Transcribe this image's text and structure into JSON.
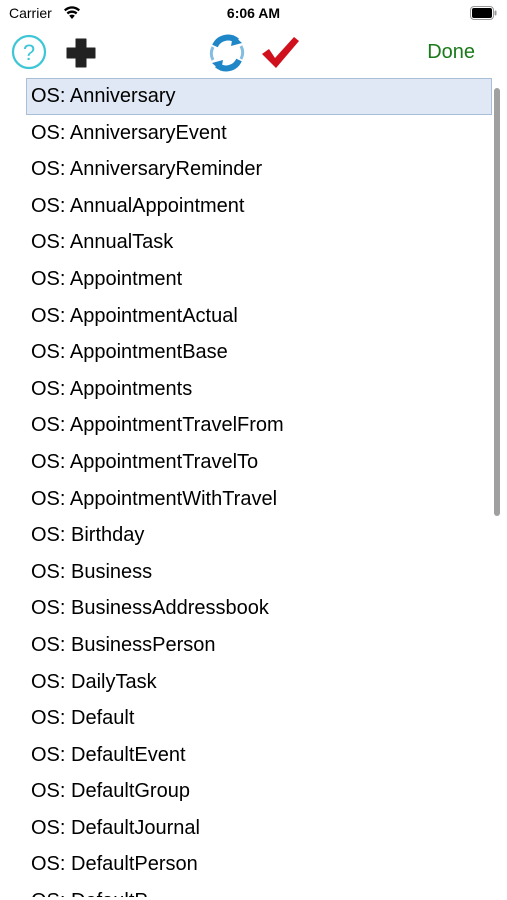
{
  "status": {
    "carrier": "Carrier",
    "time": "6:06 AM"
  },
  "toolbar": {
    "help_icon": "question-circle-icon",
    "add_icon": "plus-icon",
    "refresh_icon": "refresh-arrows-icon",
    "check_icon": "checkmark-icon",
    "done_label": "Done"
  },
  "colors": {
    "help": "#3cc6d6",
    "refresh": "#1f87c7",
    "check": "#d0101d",
    "done": "#1a7a1a",
    "selection": "#dfe8f4"
  },
  "list": {
    "selected_index": 0,
    "items": [
      "OS: Anniversary",
      "OS: AnniversaryEvent",
      "OS: AnniversaryReminder",
      "OS: AnnualAppointment",
      "OS: AnnualTask",
      "OS: Appointment",
      "OS: AppointmentActual",
      "OS: AppointmentBase",
      "OS: Appointments",
      "OS: AppointmentTravelFrom",
      "OS: AppointmentTravelTo",
      "OS: AppointmentWithTravel",
      "OS: Birthday",
      "OS: Business",
      "OS: BusinessAddressbook",
      "OS: BusinessPerson",
      "OS: DailyTask",
      "OS: Default",
      "OS: DefaultEvent",
      "OS: DefaultGroup",
      "OS: DefaultJournal",
      "OS: DefaultPerson",
      "OS: DefaultP"
    ]
  }
}
